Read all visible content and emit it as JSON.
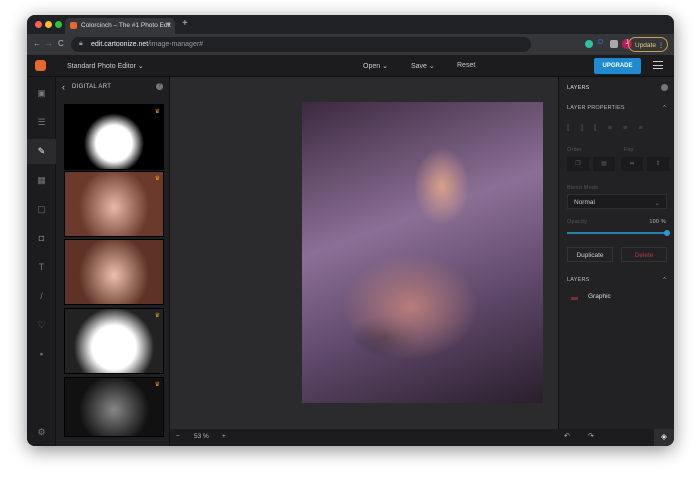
{
  "browser": {
    "tab_title": "Colorcinch – The #1 Photo Edit",
    "new_tab": "+",
    "tab_close": "×",
    "url_domain": "edit.cartoonize.net",
    "url_path": "/image-manager#",
    "update_label": "Update",
    "profile_initial": "J",
    "back": "←",
    "forward": "→",
    "reload": "C"
  },
  "header": {
    "editor_mode": "Standard Photo Editor",
    "open": "Open",
    "save": "Save",
    "reset": "Reset",
    "upgrade": "UPGRADE"
  },
  "panel": {
    "title": "DIGITAL ART",
    "back": "‹",
    "help": "?"
  },
  "canvas": {
    "zoom": "53 %",
    "zoom_out": "−",
    "zoom_in": "+"
  },
  "right": {
    "title": "LAYERS",
    "properties": "LAYER PROPERTIES",
    "order": "Order",
    "flip": "Flip",
    "blend_label": "Blend Mode",
    "blend_value": "Normal",
    "opacity_label": "Opacity",
    "opacity_value": "100 %",
    "opacity": 100,
    "duplicate": "Duplicate",
    "delete": "Delete",
    "layers_title": "LAYERS",
    "layer_name": "Graphic",
    "collapse": "^"
  },
  "colors": {
    "accent": "#1f8ad0",
    "brand": "#e8672c",
    "delete": "#b23a3a"
  }
}
